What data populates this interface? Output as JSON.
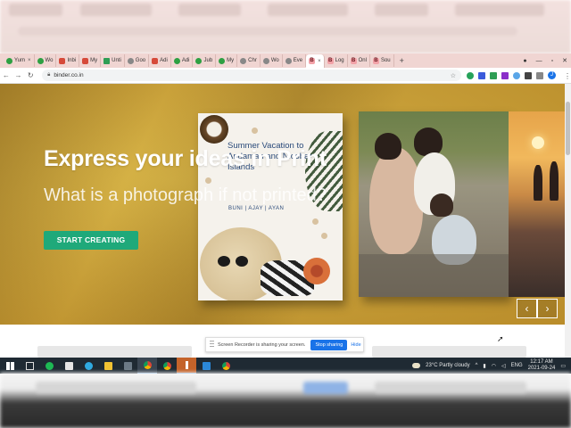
{
  "browser": {
    "tabs": [
      {
        "label": "Yum",
        "icon": "whatsapp-icon"
      },
      {
        "label": "Wo",
        "icon": "whatsapp-icon"
      },
      {
        "label": "Inbi",
        "icon": "gmail-icon"
      },
      {
        "label": "My",
        "icon": "gmail-icon"
      },
      {
        "label": "Unti",
        "icon": "sheets-icon"
      },
      {
        "label": "Goo",
        "icon": "drive-icon"
      },
      {
        "label": "Adi",
        "icon": "gmail-icon"
      },
      {
        "label": "Adi",
        "icon": "whatsapp-icon"
      },
      {
        "label": "Jub",
        "icon": "whatsapp-icon"
      },
      {
        "label": "My",
        "icon": "whatsapp-icon"
      },
      {
        "label": "Chr",
        "icon": "globe-icon"
      },
      {
        "label": "Wo",
        "icon": "globe-icon"
      },
      {
        "label": "Eve",
        "icon": "globe-icon"
      },
      {
        "label": "B",
        "icon": "binder-icon",
        "active": true
      },
      {
        "label": "Log",
        "icon": "binder-icon"
      },
      {
        "label": "Onl",
        "icon": "binder-icon"
      },
      {
        "label": "Sou",
        "icon": "binder-icon"
      }
    ],
    "url": "binder.co.in",
    "profile_initial": "J"
  },
  "hero": {
    "headline": "Express your ideas in Print",
    "subheadline": "What is a photograph if not printed?",
    "cta_label": "START CREATING",
    "book1": {
      "title": "Summer Vacation to Andaman and Nicobar Islands",
      "names": "BUNI | AJAY | AYAN"
    },
    "prev_symbol": "‹",
    "next_symbol": "›"
  },
  "screen_share": {
    "message": "Screen Recorder is sharing your screen.",
    "stop_label": "Stop sharing",
    "hide_label": "Hide"
  },
  "taskbar": {
    "weather": "23°C  Partly cloudy",
    "language": "ENG",
    "time": "12:17 AM",
    "date": "2021-09-24"
  },
  "colors": {
    "cta": "#1fa97a",
    "hero_gold": "#c9a13a",
    "taskbar": "#1f2a33",
    "stop_button": "#1a73e8"
  }
}
